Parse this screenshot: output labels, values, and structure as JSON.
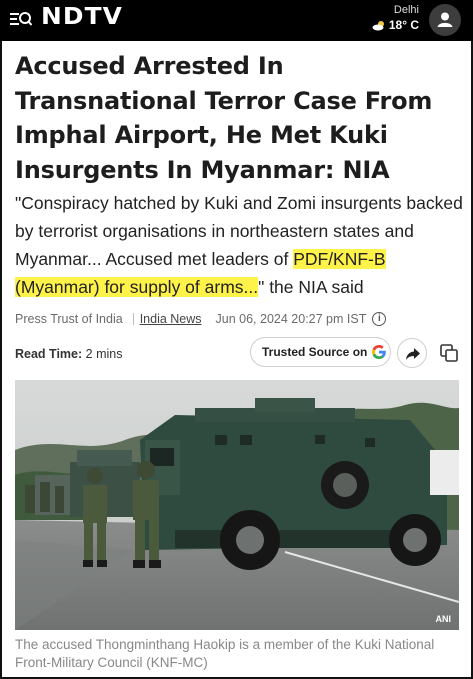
{
  "header": {
    "logo": "NDTV",
    "city": "Delhi",
    "temperature": "18° C"
  },
  "article": {
    "headline": "Accused Arrested In Transnational Terror Case From Imphal Airport, He Met Kuki Insurgents In Myanmar: NIA",
    "summary_before": "\"Conspiracy hatched by Kuki and Zomi insurgents backed by terrorist organisations in northeastern states and Myanmar... Accused met leaders of ",
    "summary_highlight": "PDF/KNF-B (Myanmar) for supply of arms...",
    "summary_after": "\" the NIA said",
    "source": "Press Trust of India",
    "category": "India News",
    "date": "Jun 06, 2024 20:27 pm IST",
    "read_time_label": "Read Time:",
    "read_time_value": "2 mins",
    "trusted_source_label": "Trusted Source on",
    "photo_credit": "ANI",
    "caption": "The accused Thongminthang Haokip is a member of the Kuki National Front-Military Council (KNF-MC)"
  },
  "colors": {
    "header_bg": "#000000",
    "highlight": "#fff34a"
  },
  "icons": [
    "menu-search-icon",
    "cloud-sun-icon",
    "user-icon",
    "info-icon",
    "google-icon",
    "share-icon",
    "copy-icon"
  ]
}
